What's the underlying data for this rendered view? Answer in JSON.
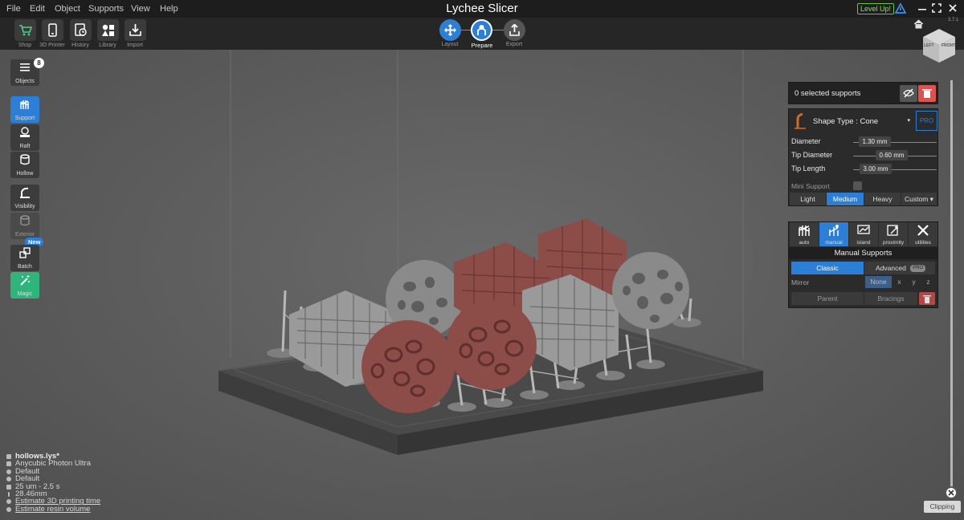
{
  "app": {
    "title": "Lychee Slicer",
    "version": "3.7.1",
    "level_up": "Level Up!"
  },
  "menu": [
    "File",
    "Edit",
    "Object",
    "Supports",
    "View",
    "Help"
  ],
  "toolbar": [
    {
      "label": "Shop",
      "icon": "cart-icon"
    },
    {
      "label": "3D Printer",
      "icon": "printer-icon"
    },
    {
      "label": "History",
      "icon": "history-icon"
    },
    {
      "label": "Library",
      "icon": "library-icon"
    },
    {
      "label": "Import",
      "icon": "import-icon"
    }
  ],
  "steps": [
    {
      "label": "Layout",
      "active": false
    },
    {
      "label": "Prepare",
      "active": true
    },
    {
      "label": "Export",
      "active": false
    }
  ],
  "view_cube": {
    "left": "LEFT",
    "front": "FRONT"
  },
  "left_tools": {
    "objects": {
      "label": "Objects",
      "badge": "8"
    },
    "support": "Support",
    "raft": "Raft",
    "hollow": "Hollow",
    "visibility": "Visibility",
    "exterior": "Exterior",
    "batch": {
      "label": "Batch",
      "badge": "New"
    },
    "magic": "Magic"
  },
  "supports_panel": {
    "selected_text": "0 selected supports",
    "shape_type": "Shape Type : Cone",
    "pro": "PRO",
    "diameter": {
      "label": "Diameter",
      "value": "1.30 mm"
    },
    "tip_diameter": {
      "label": "Tip Diameter",
      "value": "0.60 mm"
    },
    "tip_length": {
      "label": "Tip Length",
      "value": "3.00 mm"
    },
    "mini_support": "Mini Support",
    "density": [
      "Light",
      "Medium",
      "Heavy",
      "Custom ▾"
    ],
    "density_selected": "Medium",
    "tools": [
      {
        "label": "auto",
        "icon": "auto-support-icon"
      },
      {
        "label": "manual",
        "icon": "manual-support-icon"
      },
      {
        "label": "island",
        "icon": "island-icon"
      },
      {
        "label": "proximity",
        "icon": "proximity-icon"
      },
      {
        "label": "utilities",
        "icon": "utilities-icon"
      }
    ],
    "tool_selected": "manual",
    "manual_title": "Manual Supports",
    "mode_classic": "Classic",
    "mode_advanced": "Advanced",
    "mode_pro": "PRO",
    "mirror": {
      "label": "Mirror",
      "options": [
        "None",
        "x",
        "y",
        "z"
      ],
      "selected": "None"
    },
    "parent": "Parent",
    "bracings": "Bracings"
  },
  "file_info": [
    {
      "text": "hollows.lys*",
      "icon": "file-icon",
      "bold": true
    },
    {
      "text": "Anycubic Photon Ultra",
      "icon": "printer-small-icon"
    },
    {
      "text": "Default",
      "icon": "resin-icon"
    },
    {
      "text": "Default",
      "icon": "settings-small-icon"
    },
    {
      "text": "25 um - 2.5 s",
      "icon": "layers-icon"
    },
    {
      "text": "28.46mm",
      "icon": "height-icon"
    },
    {
      "text": "Estimate 3D printing time",
      "icon": "clock-icon",
      "link": true
    },
    {
      "text": "Estimate resin volume",
      "icon": "drop-icon",
      "link": true
    }
  ],
  "clipping": "Clipping",
  "colors": {
    "accent": "#2d7fd6",
    "magic": "#2fb57c",
    "delete": "#d9534f",
    "model_red": "#8c4c48",
    "model_grey": "#8d8d8d"
  }
}
